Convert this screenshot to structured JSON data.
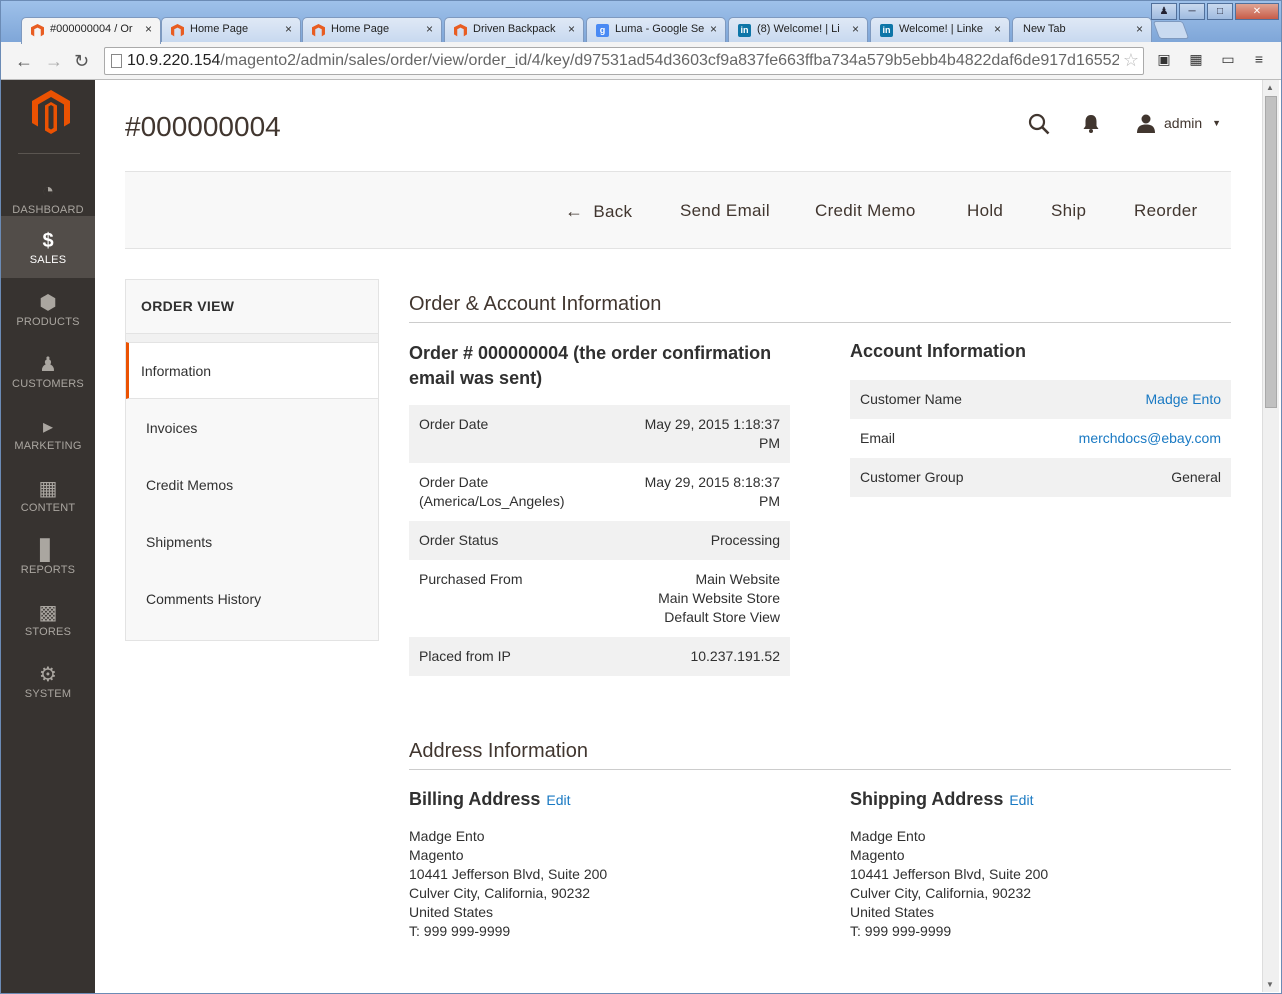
{
  "browser": {
    "tabs": [
      {
        "title": "#000000004 / Or",
        "icon": "magento-icon"
      },
      {
        "title": "Home Page",
        "icon": "magento-icon"
      },
      {
        "title": "Home Page",
        "icon": "magento-icon"
      },
      {
        "title": "Driven Backpack",
        "icon": "magento-icon"
      },
      {
        "title": "Luma - Google Se",
        "icon": "google-icon"
      },
      {
        "title": "(8) Welcome! | Li",
        "icon": "linkedin-icon"
      },
      {
        "title": "Welcome! | Linke",
        "icon": "linkedin-icon"
      },
      {
        "title": "New Tab",
        "icon": ""
      }
    ],
    "url_host": "10.9.220.154",
    "url_path": "/magento2/admin/sales/order/view/order_id/4/key/d97531ad54d3603cf9a837fe663ffba734a579b5ebb4b4822daf6de917d16552"
  },
  "sidebar": {
    "items": [
      {
        "label": "DASHBOARD",
        "icon": "dashboard-icon"
      },
      {
        "label": "SALES",
        "icon": "dollar-icon"
      },
      {
        "label": "PRODUCTS",
        "icon": "box-icon"
      },
      {
        "label": "CUSTOMERS",
        "icon": "person-icon"
      },
      {
        "label": "MARKETING",
        "icon": "megaphone-icon"
      },
      {
        "label": "CONTENT",
        "icon": "layout-icon"
      },
      {
        "label": "REPORTS",
        "icon": "bar-chart-icon"
      },
      {
        "label": "STORES",
        "icon": "store-icon"
      },
      {
        "label": "SYSTEM",
        "icon": "gear-icon"
      }
    ]
  },
  "header": {
    "title": "#000000004",
    "user": "admin"
  },
  "actions": {
    "back": "Back",
    "send_email": "Send Email",
    "credit_memo": "Credit Memo",
    "hold": "Hold",
    "ship": "Ship",
    "reorder": "Reorder"
  },
  "order_view": {
    "title": "ORDER VIEW",
    "tabs": [
      "Information",
      "Invoices",
      "Credit Memos",
      "Shipments",
      "Comments History"
    ]
  },
  "order_account": {
    "section_title": "Order & Account Information",
    "order_heading": "Order # 000000004 (the order confirmation email was sent)",
    "order_rows": [
      {
        "label": "Order Date",
        "value": "May 29, 2015 1:18:37 PM"
      },
      {
        "label": "Order Date (America/Los_Angeles)",
        "value": "May 29, 2015 8:18:37 PM"
      },
      {
        "label": "Order Status",
        "value": "Processing"
      },
      {
        "label": "Purchased From",
        "value_lines": [
          "Main Website",
          "Main Website Store",
          "Default Store View"
        ]
      },
      {
        "label": "Placed from IP",
        "value": "10.237.191.52"
      }
    ],
    "account_heading": "Account Information",
    "account_rows": [
      {
        "label": "Customer Name",
        "value": "Madge Ento"
      },
      {
        "label": "Email",
        "value": "merchdocs@ebay.com"
      },
      {
        "label": "Customer Group",
        "value": "General"
      }
    ]
  },
  "address": {
    "section_title": "Address Information",
    "edit_label": "Edit",
    "billing_title": "Billing Address",
    "shipping_title": "Shipping Address",
    "billing_lines": [
      "Madge Ento",
      "Magento",
      "10441 Jefferson Blvd, Suite 200",
      "Culver City, California, 90232",
      "United States",
      "T: 999 999-9999"
    ],
    "shipping_lines": [
      "Madge Ento",
      "Magento",
      "10441 Jefferson Blvd, Suite 200",
      "Culver City, California, 90232",
      "United States",
      "T: 999 999-9999"
    ]
  },
  "colors": {
    "sidebar_bg": "#373330",
    "accent": "#eb5202",
    "link": "#1979c3"
  }
}
